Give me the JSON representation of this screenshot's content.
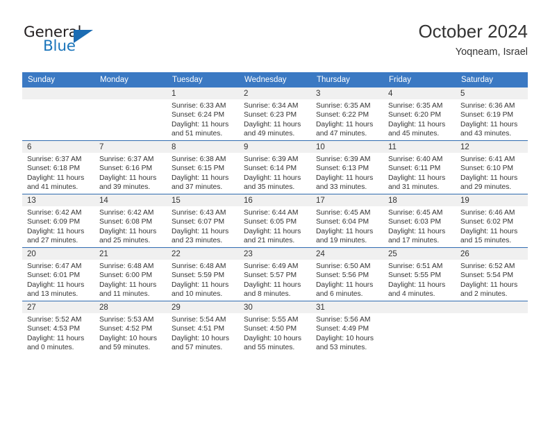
{
  "brand": {
    "name_top": "General",
    "name_bottom": "Blue",
    "colors": {
      "dark": "#231f20",
      "blue": "#1b75bb",
      "triangle": "#1b6cb3"
    }
  },
  "header": {
    "title": "October 2024",
    "location": "Yoqneam, Israel"
  },
  "theme": {
    "header_blue": "#3b79c3",
    "row_divider": "#2e6bb0",
    "daynum_band": "#f0f0f0",
    "text": "#333333"
  },
  "weekday_headers": [
    "Sunday",
    "Monday",
    "Tuesday",
    "Wednesday",
    "Thursday",
    "Friday",
    "Saturday"
  ],
  "calendar": {
    "weeks": [
      [
        {
          "day": "",
          "empty": true
        },
        {
          "day": "",
          "empty": true
        },
        {
          "day": "1",
          "sunrise": "Sunrise: 6:33 AM",
          "sunset": "Sunset: 6:24 PM",
          "daylight1": "Daylight: 11 hours",
          "daylight2": "and 51 minutes."
        },
        {
          "day": "2",
          "sunrise": "Sunrise: 6:34 AM",
          "sunset": "Sunset: 6:23 PM",
          "daylight1": "Daylight: 11 hours",
          "daylight2": "and 49 minutes."
        },
        {
          "day": "3",
          "sunrise": "Sunrise: 6:35 AM",
          "sunset": "Sunset: 6:22 PM",
          "daylight1": "Daylight: 11 hours",
          "daylight2": "and 47 minutes."
        },
        {
          "day": "4",
          "sunrise": "Sunrise: 6:35 AM",
          "sunset": "Sunset: 6:20 PM",
          "daylight1": "Daylight: 11 hours",
          "daylight2": "and 45 minutes."
        },
        {
          "day": "5",
          "sunrise": "Sunrise: 6:36 AM",
          "sunset": "Sunset: 6:19 PM",
          "daylight1": "Daylight: 11 hours",
          "daylight2": "and 43 minutes."
        }
      ],
      [
        {
          "day": "6",
          "sunrise": "Sunrise: 6:37 AM",
          "sunset": "Sunset: 6:18 PM",
          "daylight1": "Daylight: 11 hours",
          "daylight2": "and 41 minutes."
        },
        {
          "day": "7",
          "sunrise": "Sunrise: 6:37 AM",
          "sunset": "Sunset: 6:16 PM",
          "daylight1": "Daylight: 11 hours",
          "daylight2": "and 39 minutes."
        },
        {
          "day": "8",
          "sunrise": "Sunrise: 6:38 AM",
          "sunset": "Sunset: 6:15 PM",
          "daylight1": "Daylight: 11 hours",
          "daylight2": "and 37 minutes."
        },
        {
          "day": "9",
          "sunrise": "Sunrise: 6:39 AM",
          "sunset": "Sunset: 6:14 PM",
          "daylight1": "Daylight: 11 hours",
          "daylight2": "and 35 minutes."
        },
        {
          "day": "10",
          "sunrise": "Sunrise: 6:39 AM",
          "sunset": "Sunset: 6:13 PM",
          "daylight1": "Daylight: 11 hours",
          "daylight2": "and 33 minutes."
        },
        {
          "day": "11",
          "sunrise": "Sunrise: 6:40 AM",
          "sunset": "Sunset: 6:11 PM",
          "daylight1": "Daylight: 11 hours",
          "daylight2": "and 31 minutes."
        },
        {
          "day": "12",
          "sunrise": "Sunrise: 6:41 AM",
          "sunset": "Sunset: 6:10 PM",
          "daylight1": "Daylight: 11 hours",
          "daylight2": "and 29 minutes."
        }
      ],
      [
        {
          "day": "13",
          "sunrise": "Sunrise: 6:42 AM",
          "sunset": "Sunset: 6:09 PM",
          "daylight1": "Daylight: 11 hours",
          "daylight2": "and 27 minutes."
        },
        {
          "day": "14",
          "sunrise": "Sunrise: 6:42 AM",
          "sunset": "Sunset: 6:08 PM",
          "daylight1": "Daylight: 11 hours",
          "daylight2": "and 25 minutes."
        },
        {
          "day": "15",
          "sunrise": "Sunrise: 6:43 AM",
          "sunset": "Sunset: 6:07 PM",
          "daylight1": "Daylight: 11 hours",
          "daylight2": "and 23 minutes."
        },
        {
          "day": "16",
          "sunrise": "Sunrise: 6:44 AM",
          "sunset": "Sunset: 6:05 PM",
          "daylight1": "Daylight: 11 hours",
          "daylight2": "and 21 minutes."
        },
        {
          "day": "17",
          "sunrise": "Sunrise: 6:45 AM",
          "sunset": "Sunset: 6:04 PM",
          "daylight1": "Daylight: 11 hours",
          "daylight2": "and 19 minutes."
        },
        {
          "day": "18",
          "sunrise": "Sunrise: 6:45 AM",
          "sunset": "Sunset: 6:03 PM",
          "daylight1": "Daylight: 11 hours",
          "daylight2": "and 17 minutes."
        },
        {
          "day": "19",
          "sunrise": "Sunrise: 6:46 AM",
          "sunset": "Sunset: 6:02 PM",
          "daylight1": "Daylight: 11 hours",
          "daylight2": "and 15 minutes."
        }
      ],
      [
        {
          "day": "20",
          "sunrise": "Sunrise: 6:47 AM",
          "sunset": "Sunset: 6:01 PM",
          "daylight1": "Daylight: 11 hours",
          "daylight2": "and 13 minutes."
        },
        {
          "day": "21",
          "sunrise": "Sunrise: 6:48 AM",
          "sunset": "Sunset: 6:00 PM",
          "daylight1": "Daylight: 11 hours",
          "daylight2": "and 11 minutes."
        },
        {
          "day": "22",
          "sunrise": "Sunrise: 6:48 AM",
          "sunset": "Sunset: 5:59 PM",
          "daylight1": "Daylight: 11 hours",
          "daylight2": "and 10 minutes."
        },
        {
          "day": "23",
          "sunrise": "Sunrise: 6:49 AM",
          "sunset": "Sunset: 5:57 PM",
          "daylight1": "Daylight: 11 hours",
          "daylight2": "and 8 minutes."
        },
        {
          "day": "24",
          "sunrise": "Sunrise: 6:50 AM",
          "sunset": "Sunset: 5:56 PM",
          "daylight1": "Daylight: 11 hours",
          "daylight2": "and 6 minutes."
        },
        {
          "day": "25",
          "sunrise": "Sunrise: 6:51 AM",
          "sunset": "Sunset: 5:55 PM",
          "daylight1": "Daylight: 11 hours",
          "daylight2": "and 4 minutes."
        },
        {
          "day": "26",
          "sunrise": "Sunrise: 6:52 AM",
          "sunset": "Sunset: 5:54 PM",
          "daylight1": "Daylight: 11 hours",
          "daylight2": "and 2 minutes."
        }
      ],
      [
        {
          "day": "27",
          "sunrise": "Sunrise: 5:52 AM",
          "sunset": "Sunset: 4:53 PM",
          "daylight1": "Daylight: 11 hours",
          "daylight2": "and 0 minutes."
        },
        {
          "day": "28",
          "sunrise": "Sunrise: 5:53 AM",
          "sunset": "Sunset: 4:52 PM",
          "daylight1": "Daylight: 10 hours",
          "daylight2": "and 59 minutes."
        },
        {
          "day": "29",
          "sunrise": "Sunrise: 5:54 AM",
          "sunset": "Sunset: 4:51 PM",
          "daylight1": "Daylight: 10 hours",
          "daylight2": "and 57 minutes."
        },
        {
          "day": "30",
          "sunrise": "Sunrise: 5:55 AM",
          "sunset": "Sunset: 4:50 PM",
          "daylight1": "Daylight: 10 hours",
          "daylight2": "and 55 minutes."
        },
        {
          "day": "31",
          "sunrise": "Sunrise: 5:56 AM",
          "sunset": "Sunset: 4:49 PM",
          "daylight1": "Daylight: 10 hours",
          "daylight2": "and 53 minutes."
        },
        {
          "day": "",
          "empty": true
        },
        {
          "day": "",
          "empty": true
        }
      ]
    ]
  }
}
